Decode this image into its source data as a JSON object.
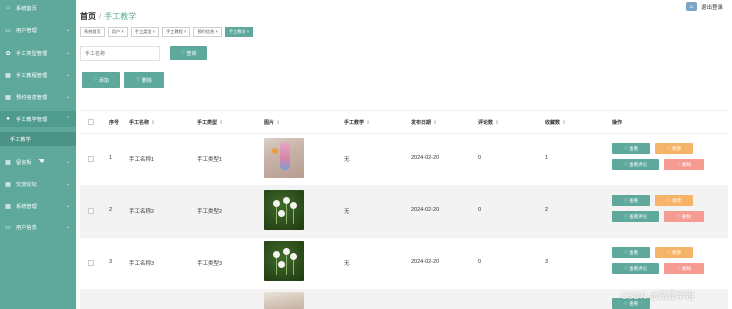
{
  "sidebar": {
    "items": [
      {
        "label": "系统首页",
        "icon": "home-icon",
        "glyph": "⌂",
        "chevron": false
      },
      {
        "label": "用户管理",
        "icon": "monitor-icon",
        "glyph": "▭",
        "chevron": true
      },
      {
        "label": "手工类型管理",
        "icon": "gear-icon",
        "glyph": "✿",
        "chevron": true
      },
      {
        "label": "手工教程管理",
        "icon": "grid-icon",
        "glyph": "▦",
        "chevron": true
      },
      {
        "label": "预约信息管理",
        "icon": "grid-icon",
        "glyph": "▦",
        "chevron": true
      },
      {
        "label": "手工教学管理",
        "icon": "user-icon",
        "glyph": "●",
        "chevron": true
      },
      {
        "label": "手工教学",
        "sub": true
      },
      {
        "label": "留言板",
        "icon": "grid-icon",
        "glyph": "▦",
        "chevron": true
      },
      {
        "label": "交流论坛",
        "icon": "grid-icon",
        "glyph": "▦",
        "chevron": true
      },
      {
        "label": "系统管理",
        "icon": "grid-icon",
        "glyph": "▦",
        "chevron": true
      },
      {
        "label": "用户信息",
        "icon": "monitor-icon",
        "glyph": "▭",
        "chevron": true
      }
    ]
  },
  "header": {
    "home": "首页",
    "separator": "/",
    "current": "手工教学",
    "logout": "退出登录"
  },
  "tabs": [
    "系统首页",
    "用户 ×",
    "手工类型 ×",
    "手工教程 ×",
    "预约信息 ×",
    "手工教学 ×"
  ],
  "search": {
    "placeholder": "手工名称",
    "button": "查询"
  },
  "toolbar": {
    "add": "添加",
    "delete": "删除"
  },
  "table": {
    "columns": [
      "序号",
      "手工名称",
      "手工类型",
      "图片",
      "手工教学",
      "发布日期",
      "评论数",
      "收藏数",
      "操作"
    ],
    "rows": [
      {
        "index": "1",
        "name": "手工名称1",
        "type": "手工类型1",
        "image": "kind1",
        "teach": "无",
        "date": "2024-02-20",
        "comments": "0",
        "favorites": "1"
      },
      {
        "index": "2",
        "name": "手工名称2",
        "type": "手工类型2",
        "image": "kind2",
        "teach": "无",
        "date": "2024-02-20",
        "comments": "0",
        "favorites": "2"
      },
      {
        "index": "3",
        "name": "手工名称3",
        "type": "手工类型3",
        "image": "kind2",
        "teach": "无",
        "date": "2024-02-20",
        "comments": "0",
        "favorites": "3"
      },
      {
        "image": "kind3"
      }
    ],
    "actions": {
      "view": "查看",
      "edit": "修改",
      "view_comments": "查看评论",
      "delete": "删除"
    }
  },
  "watermark": "CSDN @茹茹学姐",
  "colors": {
    "primary": "#5ea99c",
    "orange": "#f6b46a",
    "pink": "#f59b92"
  }
}
